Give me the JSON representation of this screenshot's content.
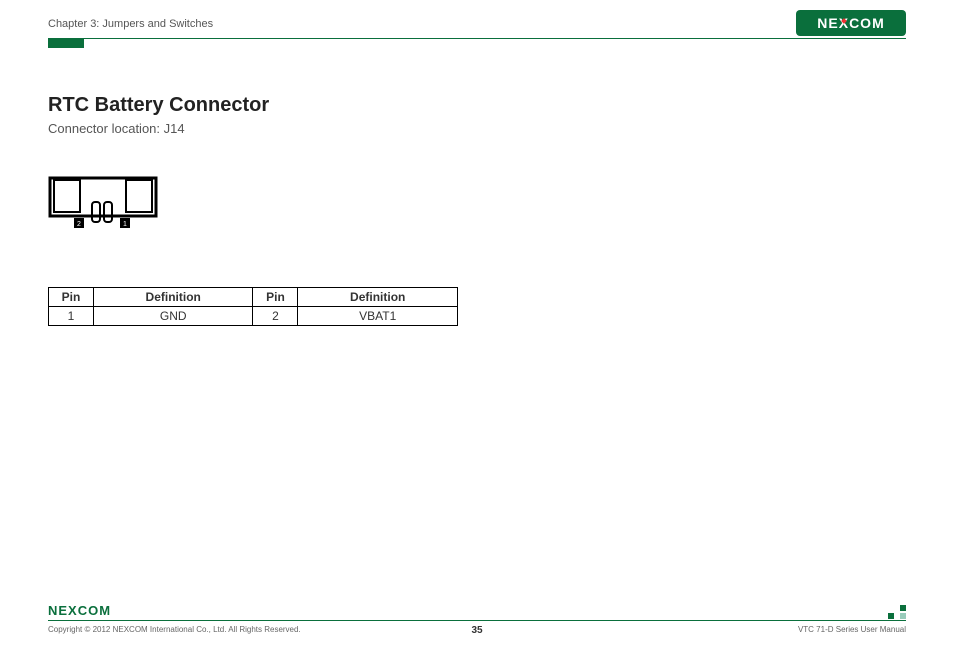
{
  "header": {
    "chapter": "Chapter 3: Jumpers and Switches",
    "brand": "NEXCOM"
  },
  "section": {
    "title": "RTC Battery Connector",
    "subtitle": "Connector location: J14"
  },
  "connector": {
    "pin_left_label": "2",
    "pin_right_label": "1"
  },
  "table": {
    "headers": {
      "pin": "Pin",
      "definition": "Definition"
    },
    "rows": [
      {
        "pin": "1",
        "definition": "GND"
      },
      {
        "pin": "2",
        "definition": "VBAT1"
      }
    ]
  },
  "footer": {
    "brand": "NEXCOM",
    "copyright": "Copyright © 2012 NEXCOM International Co., Ltd. All Rights Reserved.",
    "page": "35",
    "manual": "VTC 71-D Series User Manual"
  }
}
